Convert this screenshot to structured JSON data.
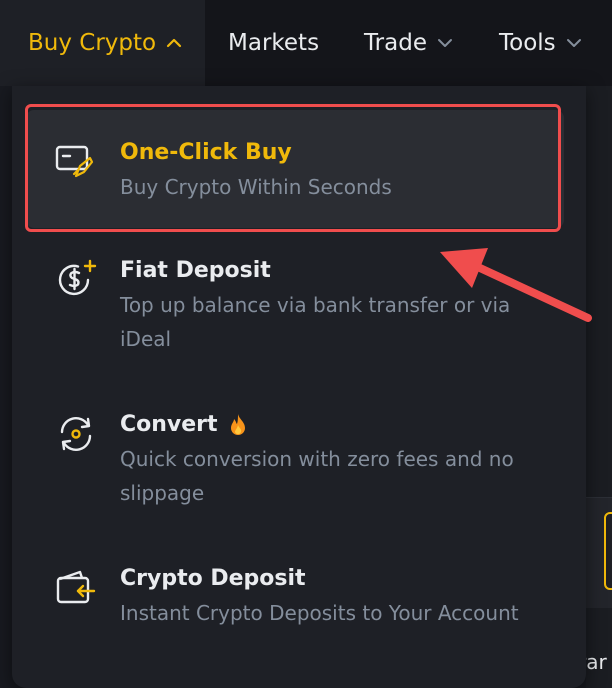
{
  "navbar": {
    "items": [
      {
        "label": "Buy Crypto",
        "active": true,
        "chevron": "chevron-up-icon"
      },
      {
        "label": "Markets"
      },
      {
        "label": "Trade",
        "chevron": "chevron-down-icon"
      },
      {
        "label": "Tools",
        "chevron": "chevron-down-icon"
      }
    ]
  },
  "dropdown": {
    "items": [
      {
        "title": "One-Click Buy",
        "desc": "Buy Crypto Within Seconds",
        "icon": "rocket-card-icon",
        "highlighted": true
      },
      {
        "title": "Fiat Deposit",
        "desc_line1": "Top up balance via bank transfer or via",
        "desc_line2": "iDeal",
        "icon": "dollar-plus-icon"
      },
      {
        "title": "Convert",
        "badge_icon": "fire-icon",
        "desc_line1": "Quick conversion with zero fees and no",
        "desc_line2": "slippage",
        "icon": "convert-cycle-icon"
      },
      {
        "title": "Crypto Deposit",
        "desc": "Instant Crypto Deposits to Your Account",
        "icon": "wallet-deposit-icon"
      }
    ]
  },
  "background": {
    "partial_text": "rar"
  },
  "colors": {
    "accent": "#f0b90b",
    "annotation": "#f04d4d",
    "text_primary": "#eaecef",
    "text_secondary": "#848e9c",
    "panel": "#1e2026"
  }
}
